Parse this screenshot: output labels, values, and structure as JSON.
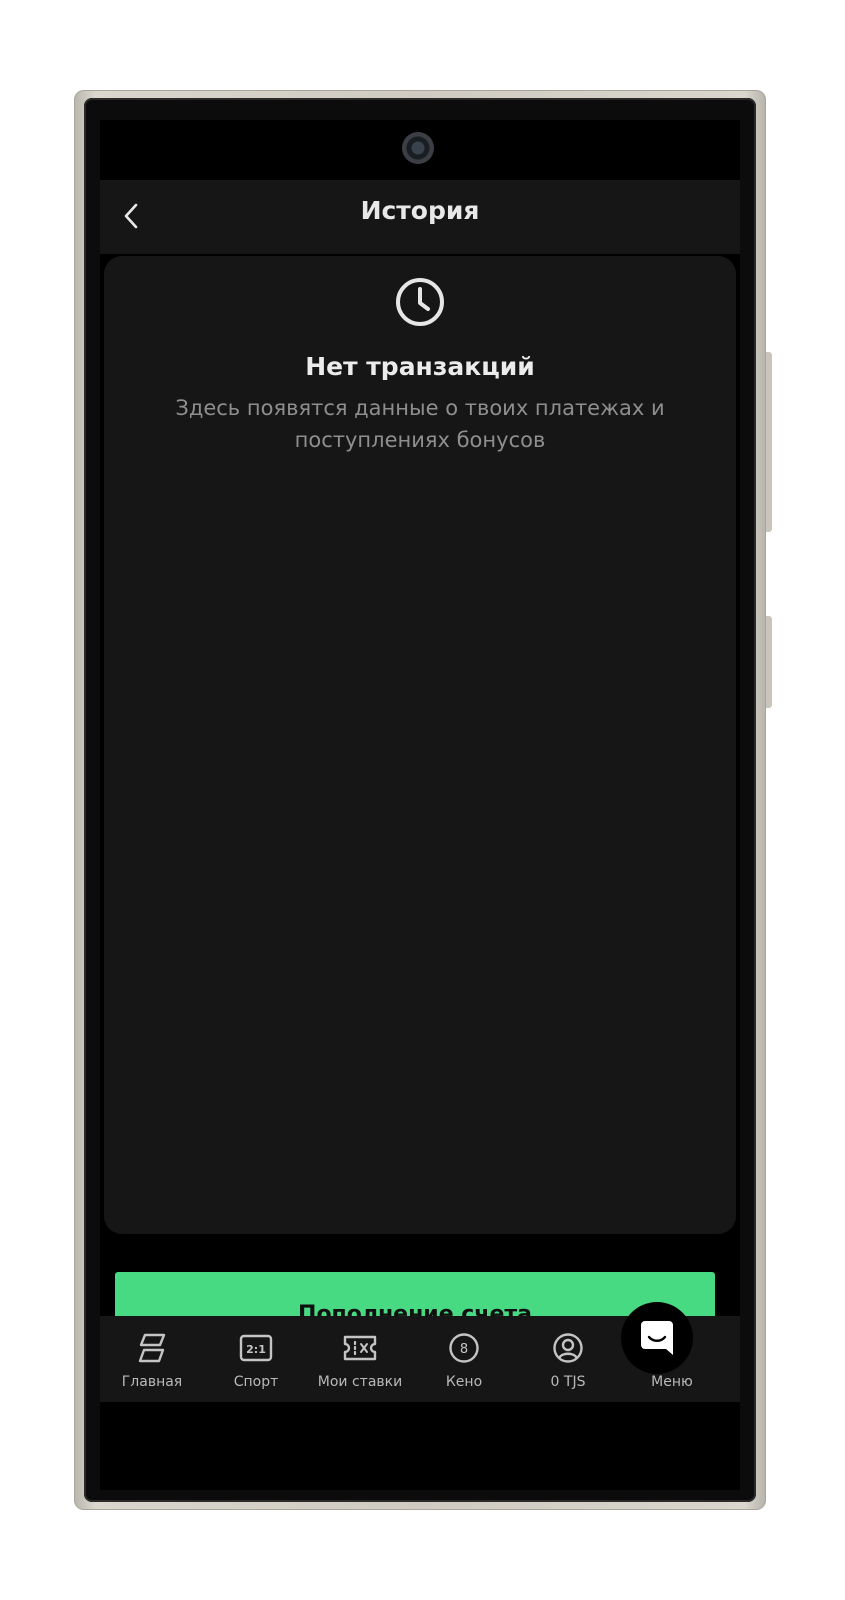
{
  "header": {
    "title": "История",
    "back_icon": "chevron-left-icon"
  },
  "empty_state": {
    "icon": "clock-icon",
    "title": "Нет транзакций",
    "description": "Здесь появятся данные о твоих платежах и поступлениях бонусов"
  },
  "cta": {
    "label": "Пополнение счета",
    "color": "#48d983"
  },
  "bottom_nav": {
    "items": [
      {
        "label": "Главная",
        "icon": "home-tiles-icon"
      },
      {
        "label": "Спорт",
        "icon": "scoreboard-icon"
      },
      {
        "label": "Мои ставки",
        "icon": "ticket-icon"
      },
      {
        "label": "Кено",
        "icon": "keno-ball-icon"
      },
      {
        "label": "0 TJS",
        "icon": "account-icon"
      },
      {
        "label": "Меню",
        "icon": "menu-icon"
      }
    ]
  },
  "chat": {
    "icon": "chat-bubble-icon"
  },
  "theme": {
    "background": "#000000",
    "surface": "#161616",
    "text_primary": "#ececec",
    "text_secondary": "#8e8e8e"
  }
}
